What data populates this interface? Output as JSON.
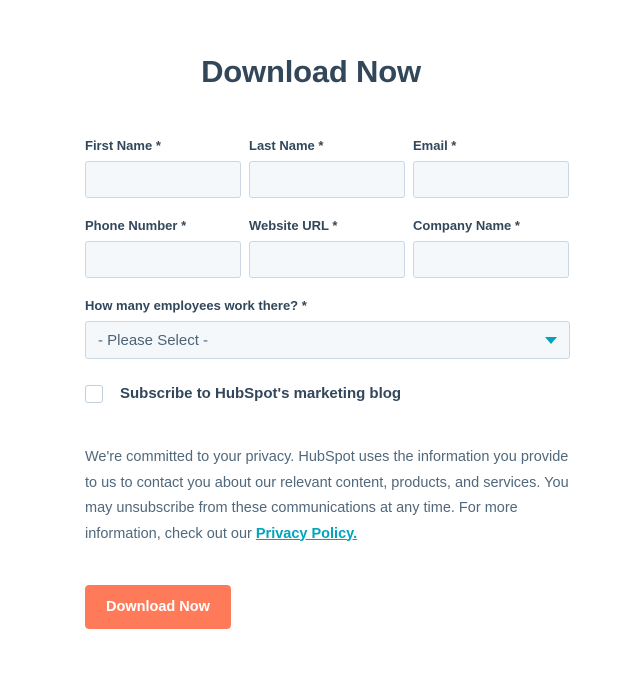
{
  "form": {
    "title": "Download Now",
    "rows": [
      {
        "fields": [
          {
            "label": "First Name",
            "required_mark": "*",
            "value": "",
            "placeholder": ""
          },
          {
            "label": "Last Name",
            "required_mark": "*",
            "value": "",
            "placeholder": ""
          },
          {
            "label": "Email ",
            "required_mark": "*",
            "value": "",
            "placeholder": ""
          }
        ]
      },
      {
        "fields": [
          {
            "label": "Phone Number",
            "required_mark": "*",
            "value": "",
            "placeholder": ""
          },
          {
            "label": "Website URL",
            "required_mark": "*",
            "value": "",
            "placeholder": ""
          },
          {
            "label": "Company Name",
            "required_mark": "*",
            "value": "",
            "placeholder": ""
          }
        ]
      }
    ],
    "employees_select": {
      "label": "How many employees work there?",
      "required_mark": "*",
      "selected": "- Please Select -",
      "arrow_icon": "chevron-down-icon",
      "arrow_color": "#00a4bd"
    },
    "subscribe_checkbox": {
      "label": "Subscribe to HubSpot's marketing blog",
      "checked": false
    },
    "privacy": {
      "text": "We're committed to your privacy. HubSpot uses the information you provide to us to contact you about our relevant content, products, and services. You may unsubscribe from these communications at any time. For more information, check out our ",
      "link_text": "Privacy Policy."
    },
    "submit_label": "Download Now"
  },
  "colors": {
    "title": "#33475b",
    "label": "#33475b",
    "input_bg": "#f5f8fa",
    "input_border": "#cbd6e2",
    "accent_teal": "#00a4bd",
    "button_orange": "#ff7a59",
    "body_text": "#51687c",
    "page_bg": "#ffffff"
  }
}
